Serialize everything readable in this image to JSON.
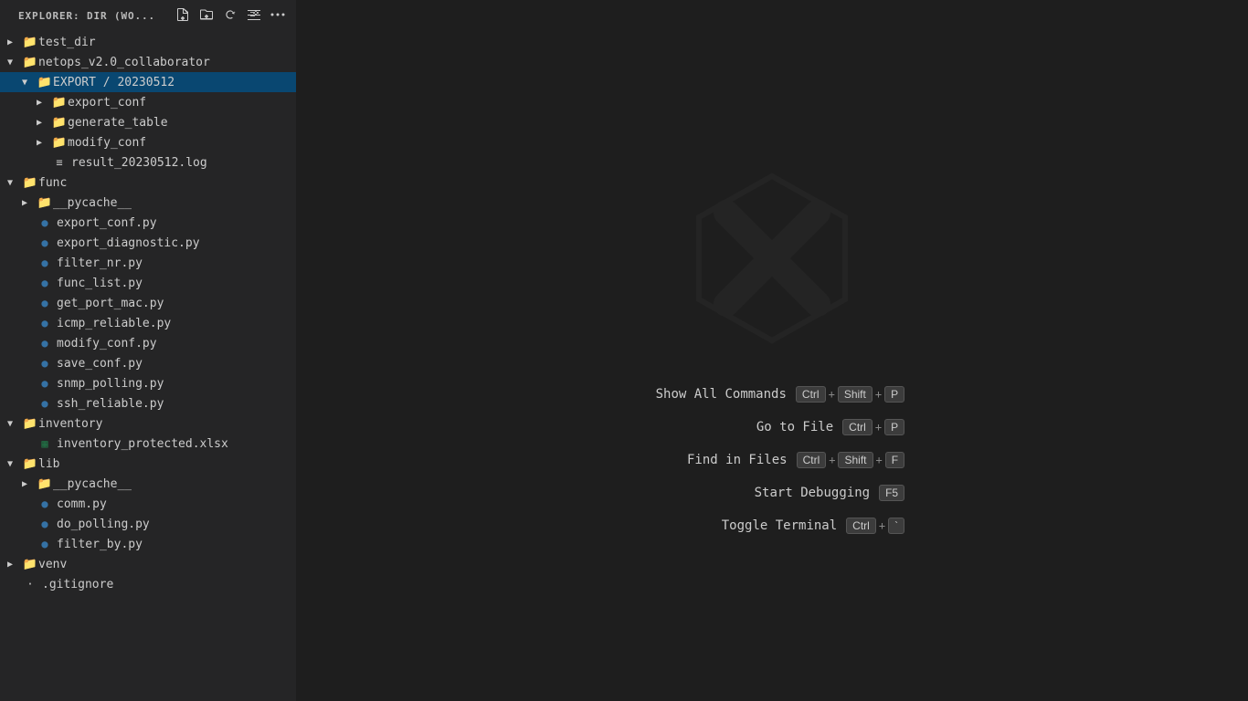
{
  "sidebar": {
    "header": "EXPLORER: DIR (WO...",
    "header_actions": [
      "new-file-icon",
      "new-folder-icon",
      "refresh-icon",
      "collapse-icon",
      "more-icon"
    ]
  },
  "tree": [
    {
      "id": "test_dir",
      "label": "test_dir",
      "type": "folder-collapsed",
      "indent": 0,
      "arrow": "▶",
      "selected": false
    },
    {
      "id": "netops_v2.0_collaborator",
      "label": "netops_v2.0_collaborator",
      "type": "folder-expanded",
      "indent": 0,
      "arrow": "▼",
      "selected": false
    },
    {
      "id": "EXPORT_20230512",
      "label": "EXPORT / 20230512",
      "type": "folder-expanded",
      "indent": 1,
      "arrow": "▼",
      "selected": true
    },
    {
      "id": "export_conf",
      "label": "export_conf",
      "type": "folder-collapsed",
      "indent": 2,
      "arrow": "▶",
      "selected": false
    },
    {
      "id": "generate_table",
      "label": "generate_table",
      "type": "folder-collapsed",
      "indent": 2,
      "arrow": "▶",
      "selected": false
    },
    {
      "id": "modify_conf",
      "label": "modify_conf",
      "type": "folder-collapsed",
      "indent": 2,
      "arrow": "▶",
      "selected": false
    },
    {
      "id": "result_20230512.log",
      "label": "result_20230512.log",
      "type": "log",
      "indent": 2,
      "arrow": "",
      "selected": false
    },
    {
      "id": "func",
      "label": "func",
      "type": "folder-expanded",
      "indent": 0,
      "arrow": "▼",
      "selected": false
    },
    {
      "id": "__pycache__",
      "label": "__pycache__",
      "type": "folder-collapsed",
      "indent": 1,
      "arrow": "▶",
      "selected": false
    },
    {
      "id": "export_conf.py",
      "label": "export_conf.py",
      "type": "py",
      "indent": 1,
      "arrow": "",
      "selected": false
    },
    {
      "id": "export_diagnostic.py",
      "label": "export_diagnostic.py",
      "type": "py",
      "indent": 1,
      "arrow": "",
      "selected": false
    },
    {
      "id": "filter_nr.py",
      "label": "filter_nr.py",
      "type": "py",
      "indent": 1,
      "arrow": "",
      "selected": false
    },
    {
      "id": "func_list.py",
      "label": "func_list.py",
      "type": "py",
      "indent": 1,
      "arrow": "",
      "selected": false
    },
    {
      "id": "get_port_mac.py",
      "label": "get_port_mac.py",
      "type": "py",
      "indent": 1,
      "arrow": "",
      "selected": false
    },
    {
      "id": "icmp_reliable.py",
      "label": "icmp_reliable.py",
      "type": "py",
      "indent": 1,
      "arrow": "",
      "selected": false
    },
    {
      "id": "modify_conf.py",
      "label": "modify_conf.py",
      "type": "py",
      "indent": 1,
      "arrow": "",
      "selected": false
    },
    {
      "id": "save_conf.py",
      "label": "save_conf.py",
      "type": "py",
      "indent": 1,
      "arrow": "",
      "selected": false
    },
    {
      "id": "snmp_polling.py",
      "label": "snmp_polling.py",
      "type": "py",
      "indent": 1,
      "arrow": "",
      "selected": false
    },
    {
      "id": "ssh_reliable.py",
      "label": "ssh_reliable.py",
      "type": "py",
      "indent": 1,
      "arrow": "",
      "selected": false
    },
    {
      "id": "inventory",
      "label": "inventory",
      "type": "folder-expanded",
      "indent": 0,
      "arrow": "▼",
      "selected": false
    },
    {
      "id": "inventory_protected.xlsx",
      "label": "inventory_protected.xlsx",
      "type": "xlsx",
      "indent": 1,
      "arrow": "",
      "selected": false
    },
    {
      "id": "lib",
      "label": "lib",
      "type": "folder-expanded",
      "indent": 0,
      "arrow": "▼",
      "selected": false
    },
    {
      "id": "__pycache__2",
      "label": "__pycache__",
      "type": "folder-collapsed",
      "indent": 1,
      "arrow": "▶",
      "selected": false
    },
    {
      "id": "comm.py",
      "label": "comm.py",
      "type": "py",
      "indent": 1,
      "arrow": "",
      "selected": false
    },
    {
      "id": "do_polling.py",
      "label": "do_polling.py",
      "type": "py",
      "indent": 1,
      "arrow": "",
      "selected": false
    },
    {
      "id": "filter_by.py",
      "label": "filter_by.py",
      "type": "py",
      "indent": 1,
      "arrow": "",
      "selected": false
    },
    {
      "id": "venv",
      "label": "venv",
      "type": "folder-collapsed",
      "indent": 0,
      "arrow": "▶",
      "selected": false
    },
    {
      "id": ".gitignore",
      "label": ".gitignore",
      "type": "generic",
      "indent": 0,
      "arrow": "",
      "selected": false
    }
  ],
  "shortcuts": [
    {
      "label": "Show All Commands",
      "keys": [
        "Ctrl",
        "+",
        "Shift",
        "+",
        "P"
      ]
    },
    {
      "label": "Go to File",
      "keys": [
        "Ctrl",
        "+",
        "P"
      ]
    },
    {
      "label": "Find in Files",
      "keys": [
        "Ctrl",
        "+",
        "Shift",
        "+",
        "F"
      ]
    },
    {
      "label": "Start Debugging",
      "keys": [
        "F5"
      ]
    },
    {
      "label": "Toggle Terminal",
      "keys": [
        "Ctrl",
        "+",
        "`"
      ]
    }
  ]
}
